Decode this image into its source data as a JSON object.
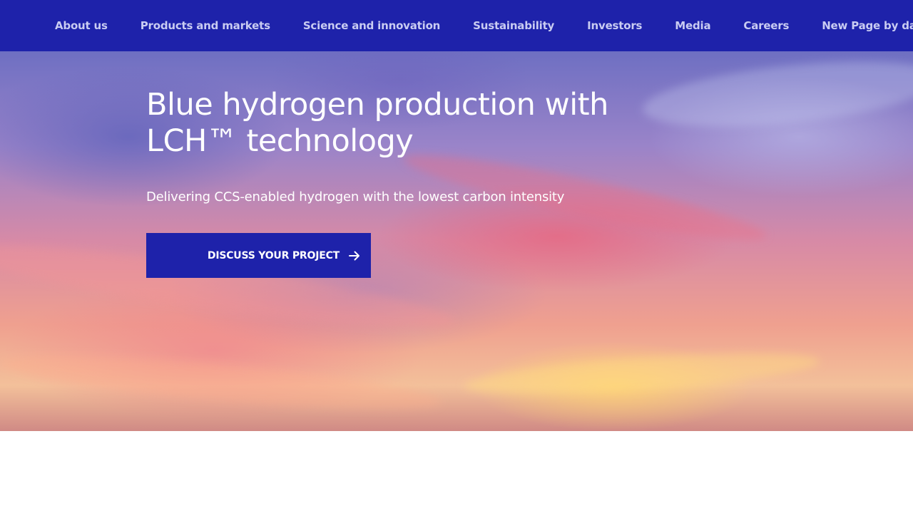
{
  "nav": {
    "items": [
      {
        "label": "About us"
      },
      {
        "label": "Products and markets"
      },
      {
        "label": "Science and innovation"
      },
      {
        "label": "Sustainability"
      },
      {
        "label": "Investors"
      },
      {
        "label": "Media"
      },
      {
        "label": "Careers"
      },
      {
        "label": "New Page by date"
      }
    ]
  },
  "hero": {
    "title_line1": "Blue hydrogen production with",
    "title_line2": "LCH™ technology",
    "subtitle": "Delivering CCS-enabled hydrogen with the lowest carbon intensity",
    "cta_label": "DISCUSS YOUR PROJECT",
    "cta_icon": "arrow-right-icon"
  },
  "colors": {
    "brand": "#1e22aa",
    "nav_text": "#c9ccf2",
    "hero_text": "#ffffff"
  }
}
